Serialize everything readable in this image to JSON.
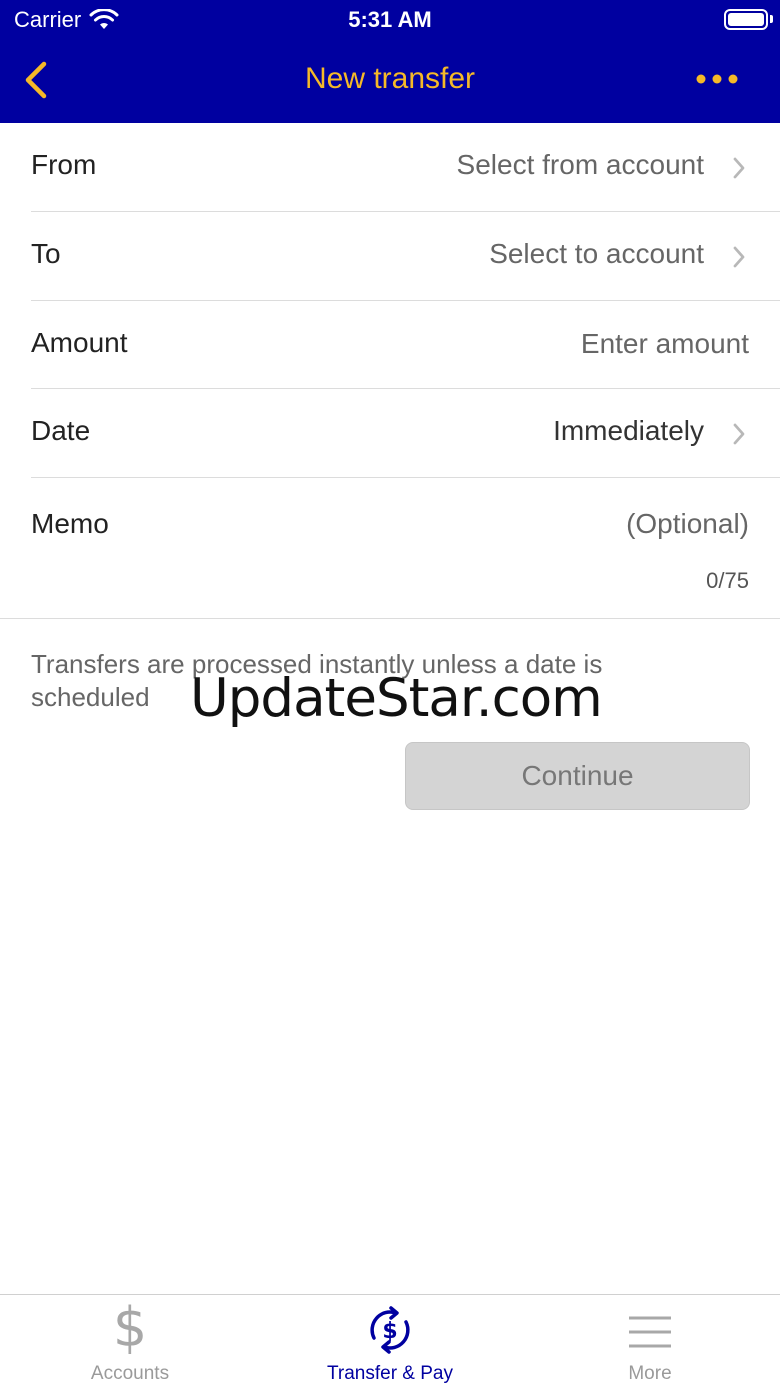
{
  "status_bar": {
    "carrier": "Carrier",
    "time": "5:31 AM"
  },
  "nav": {
    "title": "New transfer",
    "accent_color": "#f5b928",
    "background_color": "#0000a0"
  },
  "form": {
    "from": {
      "label": "From",
      "value": "Select from account"
    },
    "to": {
      "label": "To",
      "value": "Select to account"
    },
    "amount": {
      "label": "Amount",
      "placeholder": "Enter amount"
    },
    "date": {
      "label": "Date",
      "value": "Immediately"
    },
    "memo": {
      "label": "Memo",
      "placeholder": "(Optional)",
      "count": "0/75"
    }
  },
  "info": {
    "text": "Transfers are processed instantly unless a date is scheduled"
  },
  "watermark": "UpdateStar.com",
  "continue_button": {
    "label": "Continue"
  },
  "tabbar": {
    "tabs": [
      {
        "label": "Accounts",
        "icon": "dollar-icon"
      },
      {
        "label": "Transfer & Pay",
        "icon": "transfer-pay-icon",
        "selected": true
      },
      {
        "label": "More",
        "icon": "menu-icon"
      }
    ]
  }
}
